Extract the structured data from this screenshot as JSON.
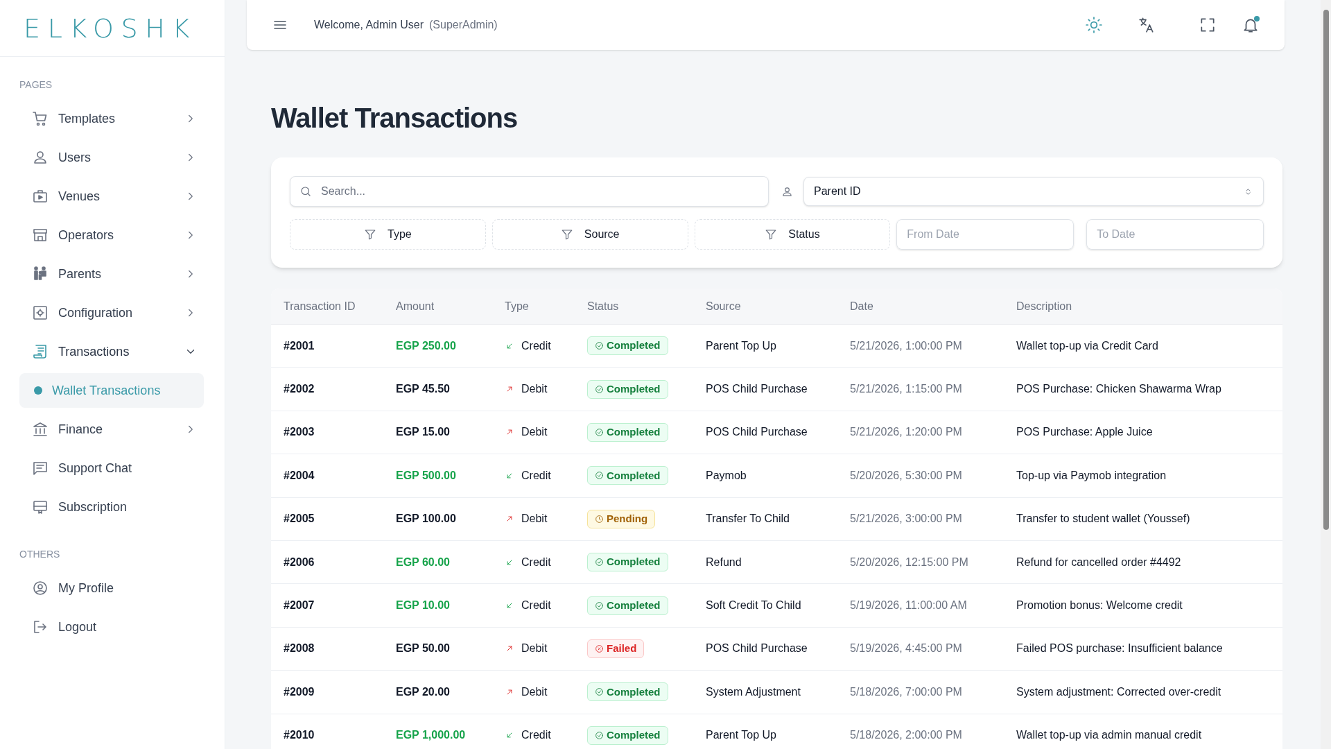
{
  "logo": "ELKOSHK",
  "sidebar": {
    "sections": [
      {
        "heading": "PAGES",
        "items": [
          {
            "label": "Templates",
            "kind": "group",
            "expanded": false
          },
          {
            "label": "Users",
            "kind": "group",
            "expanded": false
          },
          {
            "label": "Venues",
            "kind": "group",
            "expanded": false
          },
          {
            "label": "Operators",
            "kind": "group",
            "expanded": false
          },
          {
            "label": "Parents",
            "kind": "group",
            "expanded": false
          },
          {
            "label": "Configuration",
            "kind": "group",
            "expanded": false
          },
          {
            "label": "Transactions",
            "kind": "group",
            "expanded": true,
            "children": [
              {
                "label": "Wallet Transactions",
                "selected": true
              }
            ]
          },
          {
            "label": "Finance",
            "kind": "group",
            "expanded": false
          },
          {
            "label": "Support Chat",
            "kind": "link"
          },
          {
            "label": "Subscription",
            "kind": "link"
          }
        ]
      },
      {
        "heading": "OTHERS",
        "items": [
          {
            "label": "My Profile",
            "kind": "link"
          },
          {
            "label": "Logout",
            "kind": "link"
          }
        ]
      }
    ]
  },
  "header": {
    "welcome": "Welcome, Admin User",
    "role": "(SuperAdmin)",
    "notifications_unread": true
  },
  "page_title": "Wallet Transactions",
  "filters": {
    "search": {
      "placeholder": "Search..."
    },
    "parent_select": {
      "value": "Parent ID"
    },
    "filter_buttons": [
      "Type",
      "Source",
      "Status"
    ],
    "date_fields": [
      {
        "placeholder": "From Date"
      },
      {
        "placeholder": "To Date"
      }
    ]
  },
  "table": {
    "columns": [
      "Transaction ID",
      "Amount",
      "Type",
      "Status",
      "Source",
      "Date",
      "Description"
    ],
    "rows": [
      {
        "id": "#2001",
        "amount": "EGP 250.00",
        "type": {
          "kind": "credit",
          "label": "Credit"
        },
        "status": {
          "kind": "completed",
          "label": "Completed"
        },
        "source": "Parent Top Up",
        "date": "5/21/2026, 1:00:00 PM",
        "description": "Wallet top-up via Credit Card"
      },
      {
        "id": "#2002",
        "amount": "EGP 45.50",
        "type": {
          "kind": "debit",
          "label": "Debit"
        },
        "status": {
          "kind": "completed",
          "label": "Completed"
        },
        "source": "POS Child Purchase",
        "date": "5/21/2026, 1:15:00 PM",
        "description": "POS Purchase: Chicken Shawarma Wrap"
      },
      {
        "id": "#2003",
        "amount": "EGP 15.00",
        "type": {
          "kind": "debit",
          "label": "Debit"
        },
        "status": {
          "kind": "completed",
          "label": "Completed"
        },
        "source": "POS Child Purchase",
        "date": "5/21/2026, 1:20:00 PM",
        "description": "POS Purchase: Apple Juice"
      },
      {
        "id": "#2004",
        "amount": "EGP 500.00",
        "type": {
          "kind": "credit",
          "label": "Credit"
        },
        "status": {
          "kind": "completed",
          "label": "Completed"
        },
        "source": "Paymob",
        "date": "5/20/2026, 5:30:00 PM",
        "description": "Top-up via Paymob integration"
      },
      {
        "id": "#2005",
        "amount": "EGP 100.00",
        "type": {
          "kind": "debit",
          "label": "Debit"
        },
        "status": {
          "kind": "pending",
          "label": "Pending"
        },
        "source": "Transfer To Child",
        "date": "5/21/2026, 3:00:00 PM",
        "description": "Transfer to student wallet (Youssef)"
      },
      {
        "id": "#2006",
        "amount": "EGP 60.00",
        "type": {
          "kind": "credit",
          "label": "Credit"
        },
        "status": {
          "kind": "completed",
          "label": "Completed"
        },
        "source": "Refund",
        "date": "5/20/2026, 12:15:00 PM",
        "description": "Refund for cancelled order #4492"
      },
      {
        "id": "#2007",
        "amount": "EGP 10.00",
        "type": {
          "kind": "credit",
          "label": "Credit"
        },
        "status": {
          "kind": "completed",
          "label": "Completed"
        },
        "source": "Soft Credit To Child",
        "date": "5/19/2026, 11:00:00 AM",
        "description": "Promotion bonus: Welcome credit"
      },
      {
        "id": "#2008",
        "amount": "EGP 50.00",
        "type": {
          "kind": "debit",
          "label": "Debit"
        },
        "status": {
          "kind": "failed",
          "label": "Failed"
        },
        "source": "POS Child Purchase",
        "date": "5/19/2026, 4:45:00 PM",
        "description": "Failed POS purchase: Insufficient balance"
      },
      {
        "id": "#2009",
        "amount": "EGP 20.00",
        "type": {
          "kind": "debit",
          "label": "Debit"
        },
        "status": {
          "kind": "completed",
          "label": "Completed"
        },
        "source": "System Adjustment",
        "date": "5/18/2026, 7:00:00 PM",
        "description": "System adjustment: Corrected over-credit"
      },
      {
        "id": "#2010",
        "amount": "EGP 1,000.00",
        "type": {
          "kind": "credit",
          "label": "Credit"
        },
        "status": {
          "kind": "completed",
          "label": "Completed"
        },
        "source": "Parent Top Up",
        "date": "5/18/2026, 2:00:00 PM",
        "description": "Wallet top-up via admin manual credit"
      }
    ]
  }
}
